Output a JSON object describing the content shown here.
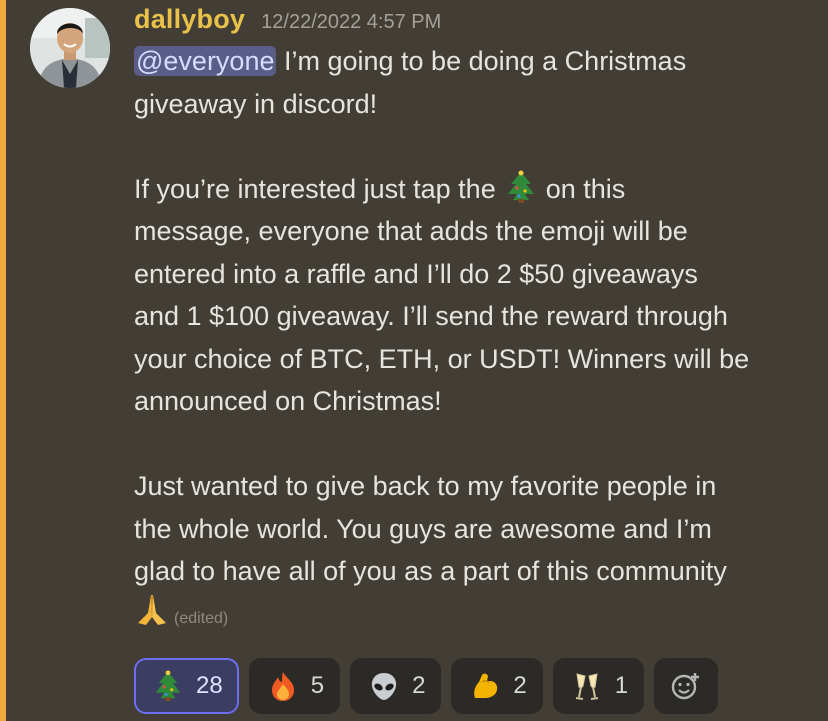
{
  "message": {
    "username": "dallyboy",
    "timestamp": "12/22/2022 4:57 PM",
    "mention": "@everyone",
    "line1_rest": " I’m going to be doing a Christmas",
    "line2": "giveaway in discord!",
    "line3_before": "If you’re interested just tap the",
    "line3_after": "on this",
    "line4": "message, everyone that adds the emoji will be",
    "line5": "entered into a raffle and I’ll do 2 $50 giveaways",
    "line6": "and 1 $100 giveaway. I’ll send the reward through",
    "line7": "your choice of BTC, ETH, or USDT! Winners will be",
    "line8": "announced on Christmas!",
    "line9": "Just wanted to give back to my favorite people in",
    "line10": "the whole world. You guys are awesome and I’m",
    "line11": "glad to have all of you as a part of this community",
    "edited": "(edited)"
  },
  "reactions": [
    {
      "icon": "christmas-tree-icon",
      "count": "28",
      "active": true
    },
    {
      "icon": "fire-icon",
      "count": "5",
      "active": false
    },
    {
      "icon": "alien-icon",
      "count": "2",
      "active": false
    },
    {
      "icon": "flexed-biceps-icon",
      "count": "2",
      "active": false
    },
    {
      "icon": "clinking-glasses-icon",
      "count": "1",
      "active": false
    }
  ],
  "add_reaction_icon": "add-reaction-icon",
  "colors": {
    "username": "#e8c24a",
    "accent_border": "#f0a93a",
    "mention_bg": "#5a5d88",
    "active_reaction_border": "#6b6ff0"
  }
}
